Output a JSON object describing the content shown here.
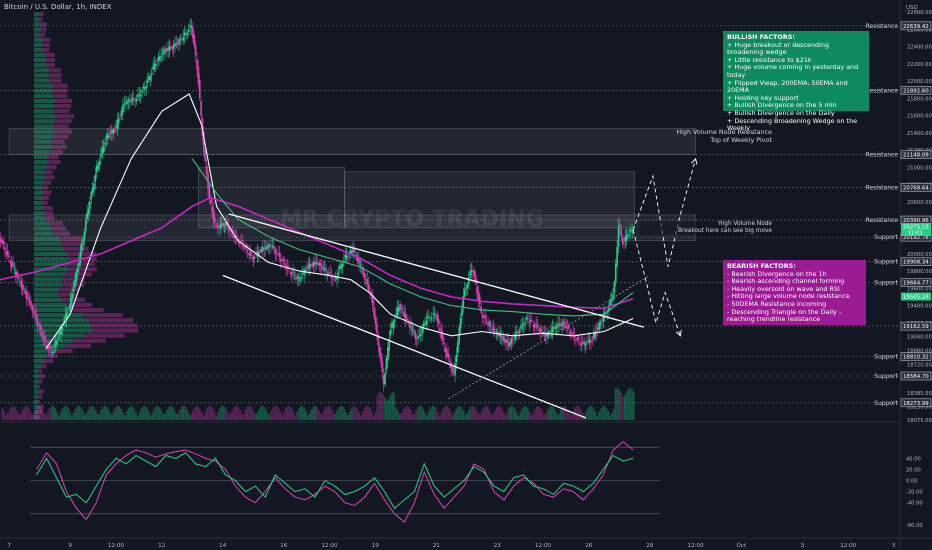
{
  "title": "Bitcoin / U.S. Dollar, 1h, INDEX",
  "colors": {
    "background": "#131722",
    "bull": "#26d08a",
    "bear": "#e040b8",
    "vwap": "#ffffff",
    "ema200": "#c826c8",
    "ema50": "#3fbf82",
    "bull_note_bg": "#0e8a5f",
    "bear_note_bg": "#9c1a93"
  },
  "bullish_note": {
    "heading": "BULLISH FACTORS:",
    "lines": [
      "+ Huge breakout or descending broadening wedge",
      "+ Little resistance to $21k",
      "+ Huge volume coming in yesterday and today",
      "+ Flipped Vwap, 200EMA, 50EMA and 20EMA",
      "+ Holding key support",
      "+ Bullish Divergence on the 5 min",
      "+ Bullish Divergence on the Daily",
      "+ Descending Broadening Wedge on the Weekly"
    ]
  },
  "bearish_note": {
    "heading": "BEARISH FACTORS:",
    "lines": [
      "- Bearish Divergence on the 1h",
      "- Bearish ascending channel forming",
      "- Heavily oversold on wave and RSI",
      "- Hitting large volume node resistance",
      "- 50DEMA Resistance incoming",
      "- Descending Triangle on the Daily - reaching trendline resistance"
    ]
  },
  "annotations": {
    "hvn_line1": "High Volume Node Resistance",
    "hvn_line2": "Top of Weekly Pivot",
    "breakout_line1": "High Volume Node",
    "breakout_line2": "Breakout here can see big move",
    "watermark": "MR CRYPTO TRADING"
  },
  "chart_data": [
    {
      "type": "candlestick",
      "title": "Bitcoin / U.S. Dollar, 1h, INDEX",
      "ylabel": "USD",
      "ylim": [
        18075,
        22800
      ],
      "xlim": [
        6.7,
        36.2
      ],
      "x_ticks": [
        {
          "x": 7,
          "label": "7"
        },
        {
          "x": 9,
          "label": "9"
        },
        {
          "x": 10.5,
          "label": "12:00"
        },
        {
          "x": 12,
          "label": "12"
        },
        {
          "x": 14,
          "label": "14"
        },
        {
          "x": 16,
          "label": "16"
        },
        {
          "x": 17.5,
          "label": "12:00"
        },
        {
          "x": 19,
          "label": "19"
        },
        {
          "x": 21,
          "label": "21"
        },
        {
          "x": 23,
          "label": "23"
        },
        {
          "x": 24.5,
          "label": "12:00"
        },
        {
          "x": 26,
          "label": "26"
        },
        {
          "x": 28,
          "label": "28"
        },
        {
          "x": 29.5,
          "label": "12:00"
        },
        {
          "x": 31,
          "label": "Oct"
        },
        {
          "x": 33,
          "label": "3"
        },
        {
          "x": 34.5,
          "label": "12:00"
        },
        {
          "x": 36,
          "label": "5"
        }
      ],
      "y_ticks": [
        22800,
        22600,
        22400,
        22200,
        22000,
        21800,
        21600,
        21400,
        21200,
        21000,
        20800,
        20600,
        20400,
        20200,
        20000,
        19800,
        19600,
        19400,
        19200,
        19040,
        18880,
        18720,
        18560,
        18385,
        18230,
        18075
      ],
      "price_levels": [
        {
          "value": 22639.42,
          "label": "Resistance"
        },
        {
          "value": 21892.6,
          "label": "Resistance"
        },
        {
          "value": 21148.09,
          "label": "Resistance"
        },
        {
          "value": 20768.64,
          "label": "Resistance"
        },
        {
          "value": 20390.96,
          "label": "Resistance"
        },
        {
          "value": 20192.78,
          "label": "Support"
        },
        {
          "value": 19908.34,
          "label": "Support"
        },
        {
          "value": 19664.77,
          "label": "Support"
        },
        {
          "value": 19162.59,
          "label": ""
        },
        {
          "value": 18810.32,
          "label": "Support"
        },
        {
          "value": 18584.7,
          "label": "Support"
        },
        {
          "value": 18273.99,
          "label": "Support"
        }
      ],
      "current_price": {
        "value": 20275.15,
        "countdown": "12:03"
      },
      "secondary_price": 19505.24,
      "price_path": [
        [
          6.7,
          20200
        ],
        [
          7.0,
          19950
        ],
        [
          7.4,
          19650
        ],
        [
          7.8,
          19350
        ],
        [
          8.1,
          19050
        ],
        [
          8.4,
          18850
        ],
        [
          8.7,
          19100
        ],
        [
          9.0,
          19400
        ],
        [
          9.3,
          19900
        ],
        [
          9.6,
          20500
        ],
        [
          9.9,
          21000
        ],
        [
          10.2,
          21350
        ],
        [
          10.5,
          21450
        ],
        [
          10.8,
          21750
        ],
        [
          11.2,
          21800
        ],
        [
          11.5,
          21950
        ],
        [
          11.8,
          22200
        ],
        [
          12.1,
          22350
        ],
        [
          12.4,
          22400
        ],
        [
          12.7,
          22500
        ],
        [
          13.0,
          22640
        ],
        [
          13.2,
          22100
        ],
        [
          13.4,
          21200
        ],
        [
          13.6,
          20600
        ],
        [
          13.8,
          20300
        ],
        [
          14.1,
          20350
        ],
        [
          14.4,
          20200
        ],
        [
          14.7,
          20100
        ],
        [
          15.0,
          19950
        ],
        [
          15.3,
          20050
        ],
        [
          15.6,
          20100
        ],
        [
          15.9,
          19950
        ],
        [
          16.2,
          19800
        ],
        [
          16.5,
          19700
        ],
        [
          16.8,
          19850
        ],
        [
          17.1,
          19900
        ],
        [
          17.4,
          19800
        ],
        [
          17.7,
          19700
        ],
        [
          18.0,
          19950
        ],
        [
          18.3,
          20050
        ],
        [
          18.6,
          19800
        ],
        [
          18.9,
          19500
        ],
        [
          19.1,
          19000
        ],
        [
          19.3,
          18500
        ],
        [
          19.5,
          19100
        ],
        [
          19.8,
          19400
        ],
        [
          20.1,
          19200
        ],
        [
          20.4,
          19000
        ],
        [
          20.7,
          19250
        ],
        [
          21.0,
          19300
        ],
        [
          21.3,
          18900
        ],
        [
          21.6,
          18600
        ],
        [
          21.9,
          19500
        ],
        [
          22.2,
          19850
        ],
        [
          22.5,
          19300
        ],
        [
          22.8,
          19150
        ],
        [
          23.1,
          19050
        ],
        [
          23.4,
          18950
        ],
        [
          23.7,
          19100
        ],
        [
          24.0,
          19250
        ],
        [
          24.3,
          19150
        ],
        [
          24.6,
          19050
        ],
        [
          24.9,
          19150
        ],
        [
          25.2,
          19200
        ],
        [
          25.5,
          19050
        ],
        [
          25.8,
          18950
        ],
        [
          26.1,
          19000
        ],
        [
          26.4,
          19200
        ],
        [
          26.7,
          19400
        ],
        [
          26.85,
          19600
        ],
        [
          27.0,
          20350
        ],
        [
          27.15,
          20100
        ],
        [
          27.3,
          20250
        ],
        [
          27.45,
          20275
        ]
      ],
      "series": [
        {
          "name": "",
          "kind": "vwap",
          "points": [
            [
              8.2,
              18900
            ],
            [
              9.0,
              19300
            ],
            [
              10.0,
              20300
            ],
            [
              11.0,
              21100
            ],
            [
              12.0,
              21650
            ],
            [
              12.9,
              21850
            ],
            [
              13.3,
              21500
            ],
            [
              13.8,
              20550
            ],
            [
              14.5,
              20150
            ],
            [
              15.5,
              19900
            ],
            [
              16.5,
              19800
            ],
            [
              17.5,
              19750
            ],
            [
              18.2,
              19700
            ],
            [
              18.8,
              19550
            ],
            [
              19.5,
              19300
            ],
            [
              20.5,
              19150
            ],
            [
              21.5,
              19050
            ],
            [
              22.5,
              19100
            ],
            [
              23.5,
              19050
            ],
            [
              24.5,
              19080
            ],
            [
              25.5,
              19050
            ],
            [
              26.5,
              19100
            ],
            [
              27.45,
              19250
            ]
          ]
        },
        {
          "name": "",
          "kind": "ema200",
          "points": [
            [
              6.7,
              19700
            ],
            [
              8.0,
              19800
            ],
            [
              10.0,
              20000
            ],
            [
              12.0,
              20300
            ],
            [
              13.0,
              20550
            ],
            [
              13.6,
              20650
            ],
            [
              14.5,
              20550
            ],
            [
              15.5,
              20400
            ],
            [
              16.5,
              20250
            ],
            [
              17.5,
              20100
            ],
            [
              18.5,
              19950
            ],
            [
              19.5,
              19750
            ],
            [
              20.5,
              19600
            ],
            [
              21.5,
              19500
            ],
            [
              22.5,
              19450
            ],
            [
              23.5,
              19420
            ],
            [
              24.5,
              19400
            ],
            [
              25.5,
              19380
            ],
            [
              26.5,
              19370
            ],
            [
              27.45,
              19480
            ]
          ]
        },
        {
          "name": "",
          "kind": "ema50",
          "points": [
            [
              13.0,
              21100
            ],
            [
              13.8,
              20700
            ],
            [
              14.5,
              20400
            ],
            [
              15.5,
              20200
            ],
            [
              16.5,
              20050
            ],
            [
              17.5,
              19950
            ],
            [
              18.5,
              19850
            ],
            [
              19.5,
              19650
            ],
            [
              20.5,
              19500
            ],
            [
              21.5,
              19400
            ],
            [
              22.5,
              19350
            ],
            [
              23.5,
              19330
            ],
            [
              24.5,
              19300
            ],
            [
              25.5,
              19280
            ],
            [
              26.5,
              19300
            ],
            [
              27.45,
              19550
            ]
          ]
        }
      ],
      "trendlines": [
        [
          [
            14.2,
            20460
          ],
          [
            27.8,
            19150
          ]
        ],
        [
          [
            14.0,
            19750
          ],
          [
            25.9,
            18100
          ]
        ],
        [
          [
            21.4,
            18320
          ],
          [
            28.0,
            19750
          ]
        ]
      ],
      "projection_paths": [
        [
          [
            27.45,
            20275
          ],
          [
            28.1,
            20900
          ],
          [
            28.6,
            19850
          ],
          [
            29.0,
            20450
          ],
          [
            29.5,
            21100
          ]
        ],
        [
          [
            27.45,
            20275
          ],
          [
            27.9,
            19650
          ],
          [
            28.2,
            19200
          ],
          [
            28.5,
            19550
          ],
          [
            29.0,
            19050
          ]
        ]
      ],
      "zones": [
        {
          "from": [
            7.0,
            21150
          ],
          "to": [
            29.5,
            21450
          ]
        },
        {
          "from": [
            7.0,
            20150
          ],
          "to": [
            29.5,
            20450
          ]
        },
        {
          "from": [
            13.2,
            20300
          ],
          "to": [
            18.0,
            21000
          ]
        },
        {
          "from": [
            18.0,
            20300
          ],
          "to": [
            27.5,
            20950
          ]
        }
      ]
    },
    {
      "type": "line",
      "title": "",
      "ylim": [
        -100,
        100
      ],
      "y_ticks": [
        40,
        20,
        0,
        -20,
        -40,
        -80
      ],
      "levels": [
        60,
        0,
        -60
      ],
      "series": [
        {
          "name": "",
          "kind": "wave",
          "values": [
            20,
            50,
            30,
            -20,
            -50,
            -70,
            -40,
            10,
            30,
            45,
            55,
            50,
            42,
            48,
            52,
            55,
            48,
            40,
            35,
            20,
            -10,
            -30,
            -40,
            -20,
            5,
            -15,
            -30,
            -35,
            -25,
            -10,
            -20,
            -40,
            -45,
            -30,
            -5,
            -35,
            -60,
            -75,
            -40,
            15,
            -25,
            -50,
            -30,
            -10,
            30,
            20,
            -20,
            -35,
            -10,
            5,
            -5,
            -25,
            -30,
            -15,
            -20,
            -35,
            -15,
            10,
            55,
            70,
            55
          ]
        },
        {
          "name": "",
          "kind": "rsi",
          "values": [
            10,
            40,
            5,
            -30,
            -25,
            -40,
            -10,
            20,
            40,
            30,
            45,
            35,
            25,
            45,
            40,
            50,
            30,
            25,
            40,
            10,
            0,
            -20,
            -10,
            -30,
            10,
            -5,
            -20,
            -15,
            -30,
            0,
            -10,
            -25,
            -20,
            -10,
            5,
            -20,
            -50,
            -35,
            -20,
            30,
            -10,
            -30,
            -15,
            0,
            25,
            15,
            -10,
            -20,
            5,
            10,
            -10,
            -15,
            -25,
            -5,
            -10,
            -20,
            -5,
            20,
            45,
            35,
            40
          ]
        }
      ]
    }
  ]
}
